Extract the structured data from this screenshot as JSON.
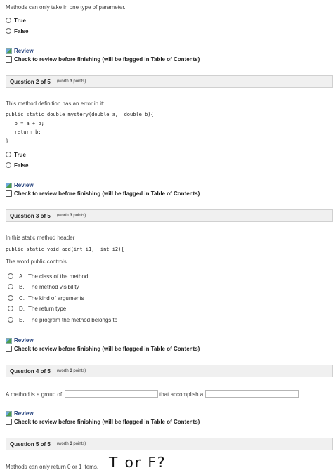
{
  "q1": {
    "prompt": "Methods can only take in one type of parameter.",
    "options": [
      "True",
      "False"
    ],
    "review_label": "Review",
    "check_label": "Check to review before finishing (will be flagged in Table of Contents)"
  },
  "q2": {
    "title": "Question 2 of 5",
    "worth_prefix": "(worth",
    "worth_num": "3",
    "worth_suffix": "points)",
    "prompt": "This method definition has an error in it:",
    "code": [
      "public static double mystery(double a,  double b){",
      "   b = a + b;",
      "   return b;",
      "}"
    ],
    "options": [
      "True",
      "False"
    ],
    "review_label": "Review",
    "check_label": "Check to review before finishing (will be flagged in Table of Contents)"
  },
  "q3": {
    "title": "Question 3 of 5",
    "worth_prefix": "(worth",
    "worth_num": "3",
    "worth_suffix": "points)",
    "prompt": "In this static method header",
    "code": "public static void add(int i1,  int i2){",
    "prompt2": "The word public controls",
    "choices": [
      {
        "letter": "A.",
        "text": "The class of the method"
      },
      {
        "letter": "B.",
        "text": "The method visibility"
      },
      {
        "letter": "C.",
        "text": "The kind of arguments"
      },
      {
        "letter": "D.",
        "text": "The return type"
      },
      {
        "letter": "E.",
        "text": "The program the method belongs to"
      }
    ],
    "review_label": "Review",
    "check_label": "Check to review before finishing (will be flagged in Table of Contents)"
  },
  "q4": {
    "title": "Question 4 of 5",
    "worth_prefix": "(worth",
    "worth_num": "3",
    "worth_suffix": "points)",
    "prompt_part1": "A method is a group of",
    "prompt_part2": "that accomplish a",
    "prompt_end": ".",
    "blank1_value": "",
    "blank2_value": "",
    "review_label": "Review",
    "check_label": "Check to review before finishing (will be flagged in Table of Contents)"
  },
  "q5": {
    "title": "Question 5 of 5",
    "worth_prefix": "(worth",
    "worth_num": "3",
    "worth_suffix": "points)",
    "prompt": "Methods can only return 0 or 1 items.",
    "handwriting": "T or F?"
  },
  "colors": {
    "header_bg": "#f0f0f0",
    "review_text": "#1f3d7a"
  }
}
